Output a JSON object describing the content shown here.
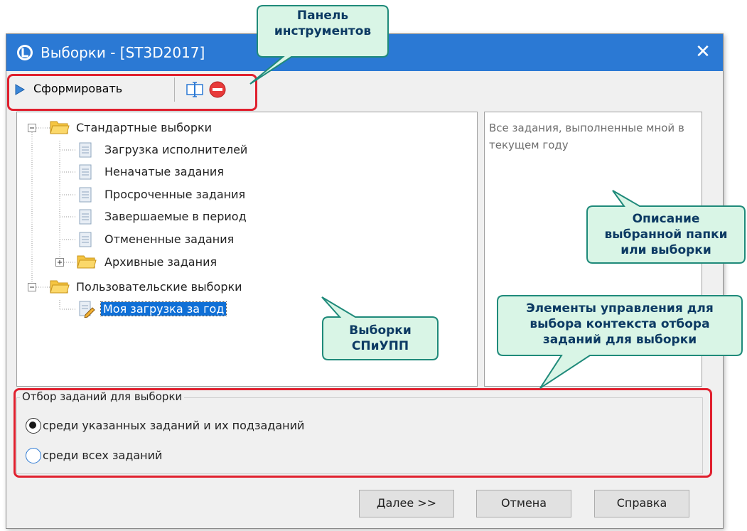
{
  "window": {
    "title": "Выборки - [ST3D2017]",
    "close_glyph": "✕",
    "title_color": "#2b79d4"
  },
  "toolbar": {
    "run_label": "Сформировать",
    "icons": [
      "play-icon",
      "field-edit-icon",
      "stop-icon"
    ]
  },
  "tree": {
    "items": [
      {
        "label": "Стандартные выборки",
        "icon": "folder-icon",
        "expander": "minus"
      },
      {
        "label": "Загрузка исполнителей",
        "icon": "document-icon"
      },
      {
        "label": "Неначатые задания",
        "icon": "document-icon"
      },
      {
        "label": "Просроченные задания",
        "icon": "document-icon"
      },
      {
        "label": "Завершаемые в период",
        "icon": "document-icon"
      },
      {
        "label": "Отмененные задания",
        "icon": "document-icon"
      },
      {
        "label": "Архивные задания",
        "icon": "folder-icon",
        "expander": "plus"
      },
      {
        "label": "Пользовательские выборки",
        "icon": "folder-icon",
        "expander": "minus"
      },
      {
        "label": "Моя загрузка за год",
        "icon": "document-edit-icon",
        "selected": true
      }
    ]
  },
  "description": {
    "text": "Все задания, выполненные мной в текущем году"
  },
  "filter": {
    "legend": "Отбор заданий для выборки",
    "options": [
      {
        "label": "среди указанных заданий и их подзаданий",
        "checked": true
      },
      {
        "label": "среди всех заданий",
        "checked": false
      }
    ]
  },
  "buttons": {
    "next": "Далее >>",
    "cancel": "Отмена",
    "help": "Справка"
  },
  "callouts": {
    "toolbar_line1": "Панель",
    "toolbar_line2": "инструментов",
    "description_line1": "Описание",
    "description_line2": "выбранной папки",
    "description_line3": "или выборки",
    "selections_line1": "Выборки",
    "selections_line2": "СПиУПП",
    "controls_line1": "Элементы управления для",
    "controls_line2": "выбора контекста отбора",
    "controls_line3": "заданий для выборки"
  },
  "colors": {
    "highlight_frame": "#e0202e",
    "callout_fill": "#d9f5e6",
    "callout_border": "#1f8a7a",
    "selection": "#0f6fd6"
  }
}
